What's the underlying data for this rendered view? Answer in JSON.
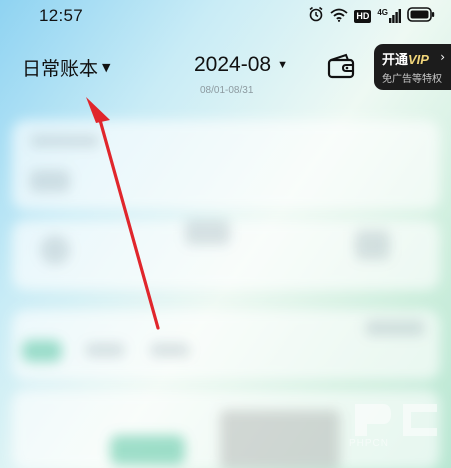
{
  "status_bar": {
    "time": "12:57",
    "icons": [
      "alarm-icon",
      "wifi-icon",
      "hd-icon",
      "cellular-4g-icon",
      "battery-icon"
    ],
    "hd_label": "HD",
    "network_label": "4G"
  },
  "header": {
    "book_label": "日常账本",
    "month_label": "2024-08",
    "date_range": "08/01-08/31",
    "wallet_icon": "wallet-icon",
    "vip": {
      "title_prefix": "开通",
      "title_vip": "VIP",
      "arrow": "›",
      "subtitle": "免广告等特权"
    }
  },
  "annotation": {
    "arrow_color": "#e0262c"
  },
  "watermark": {
    "text": "PHPCN"
  },
  "colors": {
    "vip_background": "#1c1c1c",
    "vip_accent": "#f2d67a",
    "accent_green": "#6ecdaf"
  }
}
